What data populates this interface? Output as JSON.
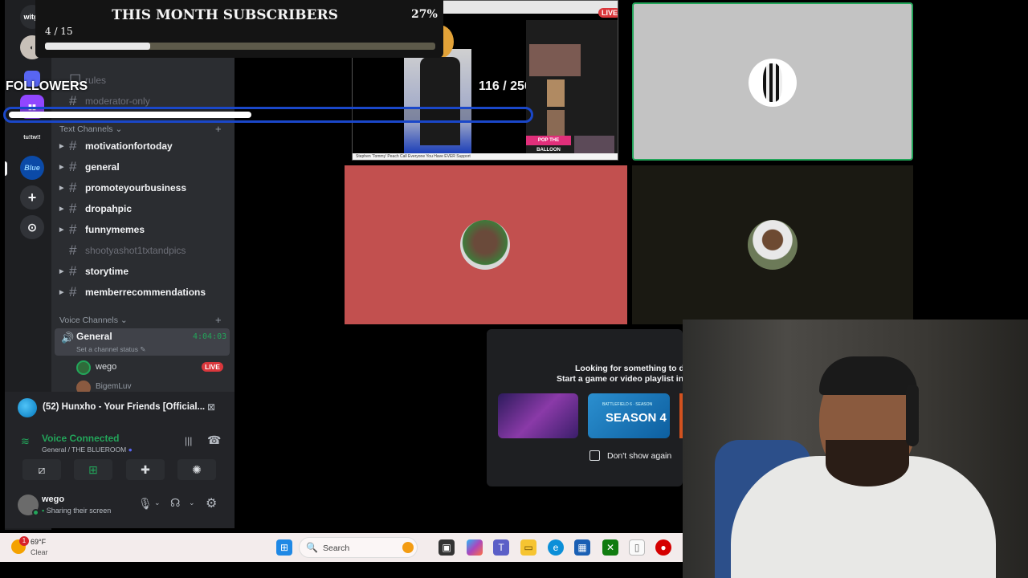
{
  "overlay": {
    "subscribers_title": "THIS MONTH SUBSCRIBERS",
    "subscribers_count": "4 / 15",
    "subscribers_percent": "27%",
    "subscribers_progress": 0.27,
    "followers_label": "FOLLOWERS"
  },
  "rail": {
    "server_label_top": "witg!",
    "twitch_label": "twitch",
    "server_label_mid": "tu!tw!!",
    "server_label_blue": "Blue"
  },
  "sidebar": {
    "pinned_channels": [
      "rules",
      "moderator-only"
    ],
    "text_category": "Text Channels",
    "channels": [
      {
        "name": "motivationfortoday",
        "muted": false
      },
      {
        "name": "general",
        "muted": false
      },
      {
        "name": "promoteyourbusiness",
        "muted": false
      },
      {
        "name": "dropahpic",
        "muted": false
      },
      {
        "name": "funnymemes",
        "muted": false
      },
      {
        "name": "shootyashot1txtandpics",
        "muted": true
      },
      {
        "name": "storytime",
        "muted": false
      },
      {
        "name": "memberrecommendations",
        "muted": false
      }
    ],
    "voice_category": "Voice Channels",
    "voice_channel": {
      "name": "General",
      "timer": "4:04:03",
      "status_placeholder": "Set a channel status",
      "members": [
        {
          "name": "wego",
          "badge": "LIVE"
        },
        {
          "name": "BigemLuv"
        }
      ]
    }
  },
  "media": {
    "title": "(52) Hunxho - Your Friends [Official..."
  },
  "voice": {
    "status": "Voice Connected",
    "channel": "General / THE BLUEROOM"
  },
  "user": {
    "name": "wego",
    "status": "Sharing their screen"
  },
  "stream_tile": {
    "live_badge": "LIVE",
    "counter": "116 / 250",
    "caption": "Stephen 'Tommy' Peach Call Everyone You Have EVER Support",
    "banner": "POP THE BALLOON"
  },
  "activity": {
    "line1": "Looking for something to do?",
    "line2": "Start a game or video playlist insta",
    "card2_sub": "BATTLEFIELD 6 · SEASON",
    "card2_title": "SEASON 4",
    "checkbox_label": "Don't show again"
  },
  "taskbar": {
    "weather_temp": "69°F",
    "weather_desc": "Clear",
    "weather_badge": "1",
    "search_label": "Search"
  },
  "colors": {
    "discord_green": "#23a55a",
    "live_red": "#da373c",
    "tile_red": "#c2504f",
    "overlay_blue": "#1a47c9"
  }
}
